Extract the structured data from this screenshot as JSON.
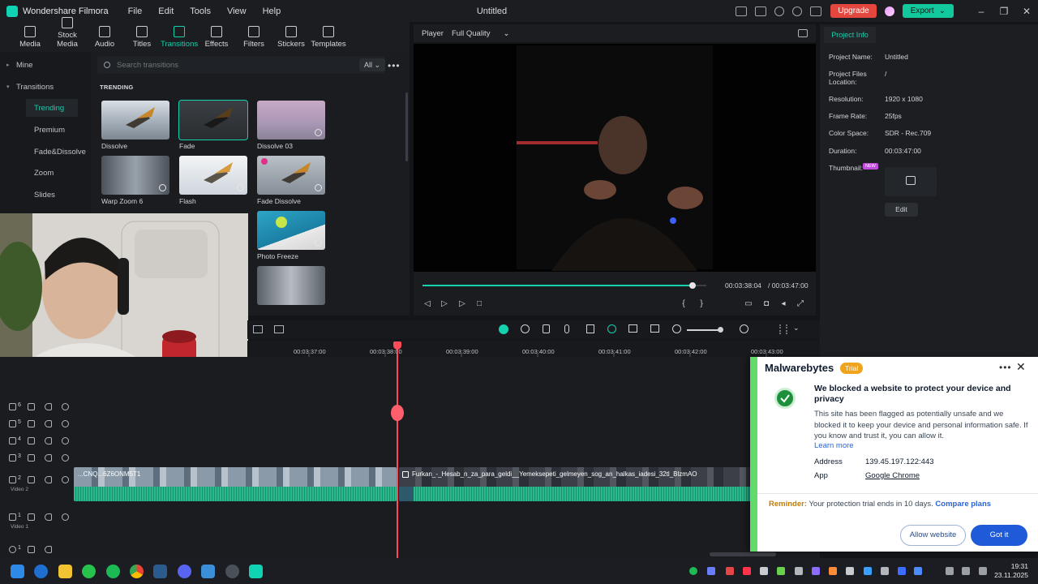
{
  "titlebar": {
    "app_name": "Wondershare Filmora",
    "menu": [
      "File",
      "Edit",
      "Tools",
      "View",
      "Help"
    ],
    "document": "Untitled",
    "upgrade_label": "Upgrade",
    "export_label": "Export"
  },
  "toolbar": {
    "items": [
      {
        "label": "Media",
        "icon": "media-icon"
      },
      {
        "label": "Stock Media",
        "icon": "stock-media-icon"
      },
      {
        "label": "Audio",
        "icon": "audio-icon"
      },
      {
        "label": "Titles",
        "icon": "titles-icon"
      },
      {
        "label": "Transitions",
        "icon": "transitions-icon",
        "active": true
      },
      {
        "label": "Effects",
        "icon": "effects-icon"
      },
      {
        "label": "Filters",
        "icon": "filters-icon"
      },
      {
        "label": "Stickers",
        "icon": "stickers-icon"
      },
      {
        "label": "Templates",
        "icon": "templates-icon"
      }
    ]
  },
  "leftnav": {
    "mine": "Mine",
    "transitions": "Transitions",
    "items": [
      "Trending",
      "Premium",
      "Fade&Dissolve",
      "Zoom",
      "Slides"
    ]
  },
  "transitions_panel": {
    "search_placeholder": "Search transitions",
    "filter_value": "All",
    "section": "TRENDING",
    "items": [
      "Dissolve",
      "Fade",
      "Dissolve 03",
      "Warp Zoom 6",
      "Flash",
      "Fade Dissolve",
      "Photo Freeze"
    ]
  },
  "player": {
    "tab": "Player",
    "quality": "Full Quality",
    "current_time": "00:03:38:04",
    "total_time": "/ 00:03:47:00",
    "progress": 0.95
  },
  "project_info": {
    "tab": "Project Info",
    "fields": [
      {
        "key": "Project Name:",
        "value": "Untitled"
      },
      {
        "key": "Project Files Location:",
        "value": "/"
      },
      {
        "key": "Resolution:",
        "value": "1920 x 1080"
      },
      {
        "key": "Frame Rate:",
        "value": "25fps"
      },
      {
        "key": "Color Space:",
        "value": "SDR - Rec.709"
      },
      {
        "key": "Duration:",
        "value": "00:03:47:00"
      }
    ],
    "thumbnail_label": "Thumbnail:",
    "new_badge": "NEW",
    "edit_label": "Edit"
  },
  "timeline": {
    "ruler": [
      "00:03:37:00",
      "00:03:38:00",
      "00:03:39:00",
      "00:03:40:00",
      "00:03:41:00",
      "00:03:42:00",
      "00:03:43:00"
    ],
    "track_numbers": [
      "6",
      "5",
      "4",
      "3",
      "2",
      "1",
      "1"
    ],
    "track_labels": [
      "Video 2",
      "Video 1"
    ],
    "clip_left_label": "...CNQ...6Z6ONM5T1",
    "clip_right_label": "Furkan_-_Hesab_n_za_para_geldi__Yemeksepeti_gelmeyen_sog_an_halkas_iadesi_32tl_BlzmAO"
  },
  "malwarebytes": {
    "brand": "Malwarebytes",
    "trial": "Trial",
    "heading": "We blocked a website to protect your device and privacy",
    "body": "This site has been flagged as potentially unsafe and we blocked it to keep your device and personal information safe. If you know and trust it, you can allow it.",
    "learn_more": "Learn more",
    "address_label": "Address",
    "address_value": "139.45.197.122:443",
    "app_label": "App",
    "app_value": "Google Chrome",
    "reminder_label": "Reminder:",
    "reminder_text": "Your protection trial ends in 10 days.",
    "compare_plans": "Compare plans",
    "allow_label": "Allow website",
    "got_it_label": "Got it"
  },
  "taskbar": {
    "time": "19:31",
    "date": "23.11.2025"
  },
  "colors": {
    "accent": "#15d1ae",
    "upgrade": "#e3473d",
    "playhead": "#ff4a5a",
    "mwb_blue": "#1f5bd8",
    "mwb_green": "#62d96b"
  }
}
